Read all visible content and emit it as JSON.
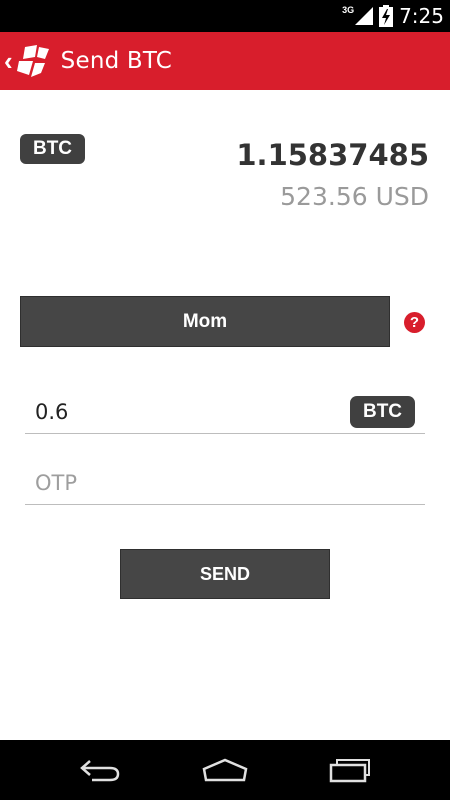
{
  "status_bar": {
    "network": "3G",
    "time": "7:25"
  },
  "app_bar": {
    "title": "Send BTC",
    "icons": [
      "back-icon",
      "app-logo-icon"
    ]
  },
  "balance": {
    "currency": "BTC",
    "amount": "1.15837485",
    "fiat": "523.56 USD"
  },
  "recipient": {
    "label": "Mom",
    "help": "?"
  },
  "amount": {
    "value": "0.6",
    "unit": "BTC"
  },
  "otp": {
    "placeholder": "OTP",
    "value": ""
  },
  "send": {
    "label": "SEND"
  },
  "colors": {
    "accent": "#d81e2c",
    "dark": "#464646",
    "muted": "#9a9a9a"
  },
  "nav_bar": {
    "icons": [
      "back-nav-icon",
      "home-nav-icon",
      "recents-nav-icon"
    ]
  }
}
